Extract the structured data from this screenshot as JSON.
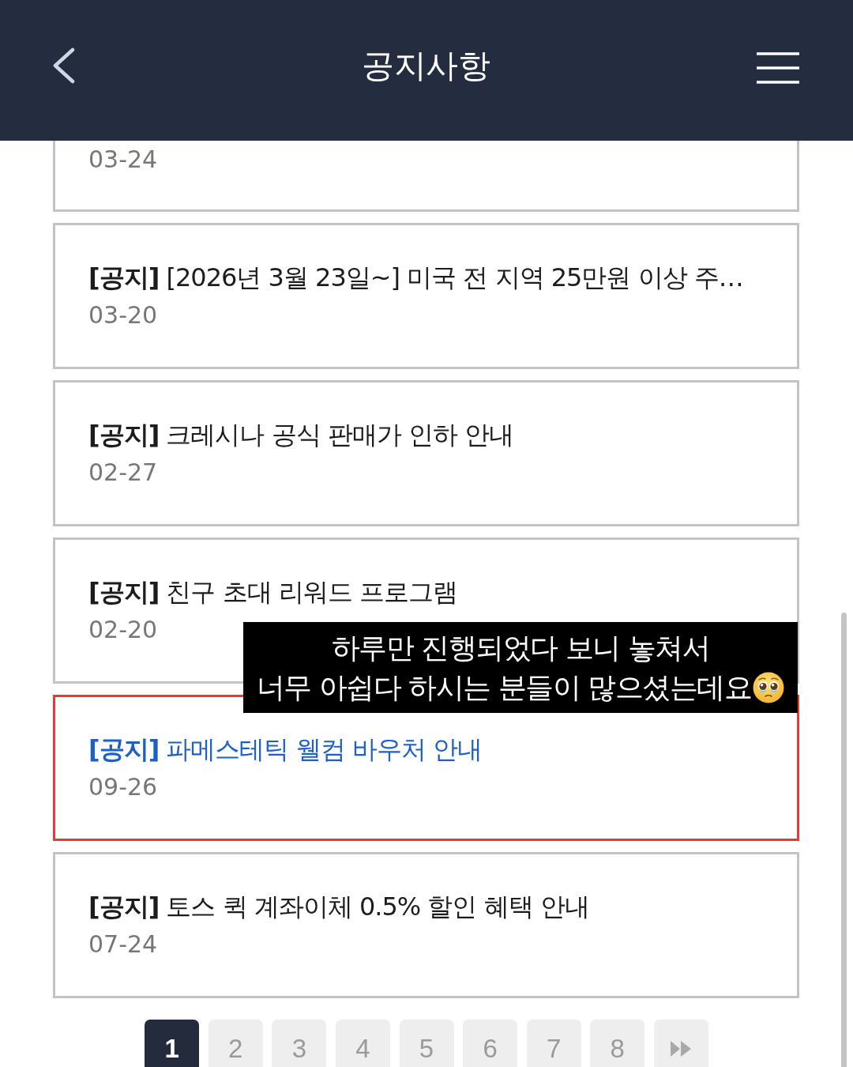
{
  "header": {
    "title": "공지사항"
  },
  "notices": [
    {
      "date": "03-24",
      "selected": false
    },
    {
      "title": "**[공지]** [2026년 3월 23일~] 미국 전 지역 25만원 이상 주…",
      "date": "03-20",
      "selected": false
    },
    {
      "title": "**[공지]** 크레시나 공식 판매가 인하 안내",
      "date": "02-27",
      "selected": false
    },
    {
      "title": "**[공지]** 친구 초대 리워드 프로그램",
      "date": "02-20",
      "selected": false
    },
    {
      "title": "**[공지]** 파메스테틱 웰컴 바우처 안내",
      "date": "09-26",
      "selected": true
    },
    {
      "title": "**[공지]** 토스 퀵 계좌이체 0.5% 할인 혜택 안내",
      "date": "07-24",
      "selected": false
    }
  ],
  "caption": {
    "lines": [
      "하루만 진행되었다 보니 놓쳐서",
      "너무 아쉽다 하시는 분들이 많으셨는데요"
    ]
  },
  "pagination": {
    "pages": [
      {
        "label": "1",
        "selected": true
      },
      {
        "label": "2",
        "selected": false
      },
      {
        "label": "3",
        "selected": false
      },
      {
        "label": "4",
        "selected": false
      },
      {
        "label": "5",
        "selected": false
      },
      {
        "label": "6",
        "selected": false
      },
      {
        "label": "7",
        "selected": false
      },
      {
        "label": "8",
        "selected": false
      }
    ]
  }
}
